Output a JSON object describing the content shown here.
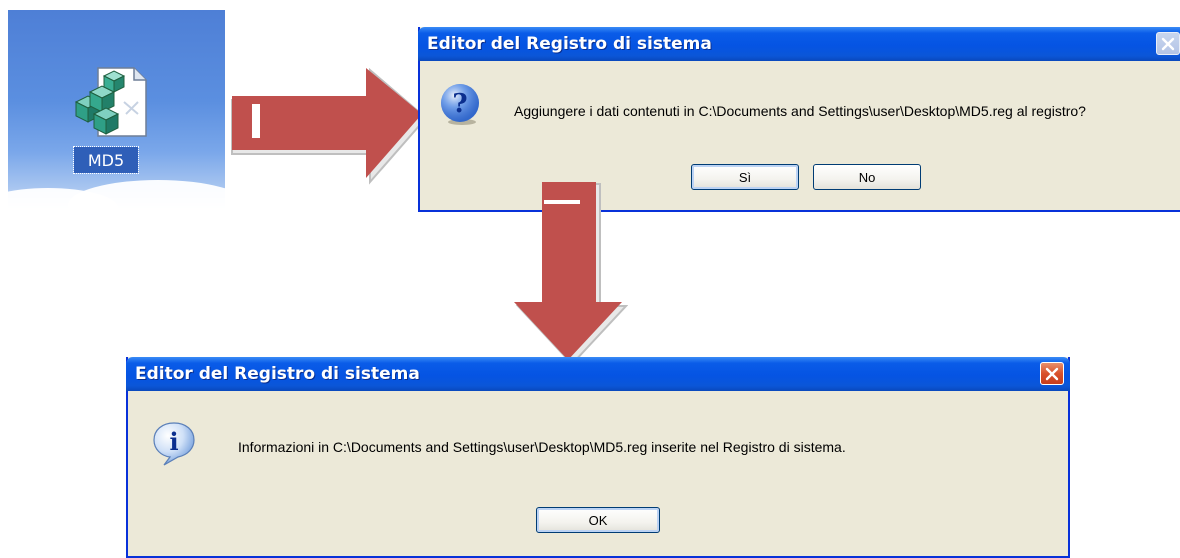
{
  "desktop": {
    "file_label": "MD5",
    "file_icon": "registry-file-icon"
  },
  "dialog_confirm": {
    "title": "Editor del Registro di sistema",
    "message": "Aggiungere i dati contenuti in C:\\Documents and Settings\\user\\Desktop\\MD5.reg al registro?",
    "icon": "question-icon",
    "yes_label": "Sì",
    "no_label": "No",
    "close_enabled": false
  },
  "dialog_info": {
    "title": "Editor del Registro di sistema",
    "message": "Informazioni in C:\\Documents and Settings\\user\\Desktop\\MD5.reg inserite nel Registro di sistema.",
    "icon": "info-icon",
    "ok_label": "OK",
    "close_enabled": true
  },
  "colors": {
    "arrow": "#c0504d",
    "titlebar": "#0554e3",
    "dialog_bg": "#ece9d8"
  }
}
